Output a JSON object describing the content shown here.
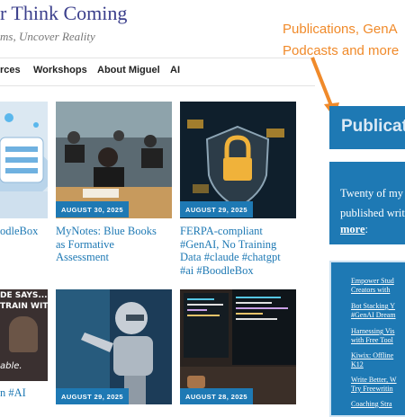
{
  "header": {
    "site_title": "r Think Coming",
    "tagline": "ms, Uncover Reality"
  },
  "nav": {
    "items": [
      "rces",
      "Workshops",
      "About Miguel",
      "AI"
    ]
  },
  "annotation": {
    "line1": "Publications, GenA",
    "line2": "Podcasts and more",
    "color": "#f08a2a"
  },
  "posts": [
    {
      "date": "",
      "title_lines": [
        "odleBox"
      ]
    },
    {
      "date": "AUGUST 30, 2025",
      "title_lines": [
        "MyNotes: Blue Books",
        "as Formative",
        "Assessment"
      ]
    },
    {
      "date": "AUGUST 29, 2025",
      "title_lines": [
        "FERPA-compliant",
        "#GenAI, No Training",
        "Data #claude #chatgpt",
        "#ai #BoodleBox"
      ]
    },
    {
      "date": "",
      "title_lines": [
        "n #AI"
      ],
      "image_text": [
        "DE SAYS...\"Y",
        "TRAIN WITH",
        "able."
      ]
    },
    {
      "date": "AUGUST 29, 2025",
      "title_lines": []
    },
    {
      "date": "AUGUST 28, 2025",
      "title_lines": []
    }
  ],
  "sidebar": {
    "heading": "Publicat",
    "intro_line1": "Twenty of my",
    "intro_line2": "published writ",
    "more_link": "more",
    "more_suffix": ":",
    "links": [
      [
        "Empower Stud",
        "Creators with"
      ],
      [
        "Bot Stacking Y",
        "#GenAI Dream"
      ],
      [
        "Harnessing Vis",
        "with Free Tool"
      ],
      [
        "Kiwix: Offline",
        "K12"
      ],
      [
        "Write Better, W",
        "Try Freewritin"
      ],
      [
        "Coaching Stra"
      ]
    ]
  },
  "colors": {
    "accent": "#1e79b4",
    "title": "#3b3f8c",
    "annotation": "#f08a2a"
  }
}
